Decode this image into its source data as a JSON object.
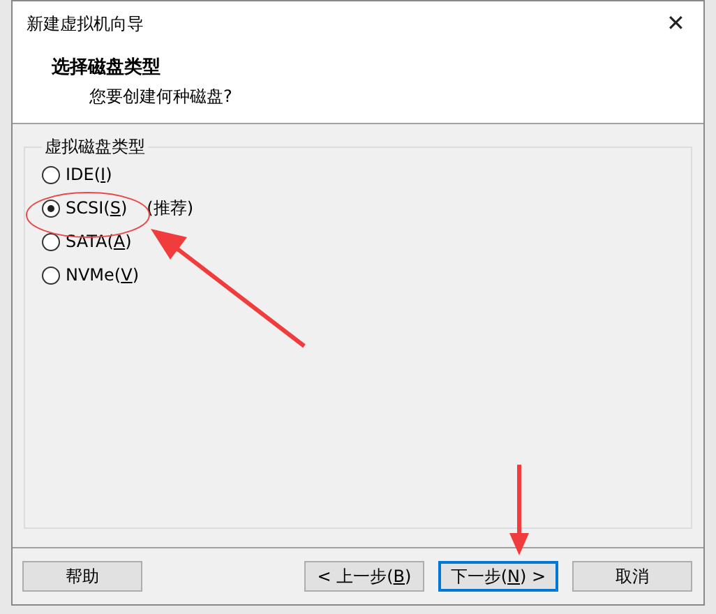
{
  "window": {
    "title": "新建虚拟机向导",
    "close": "✕"
  },
  "header": {
    "title": "选择磁盘类型",
    "subtitle": "您要创建何种磁盘?"
  },
  "group": {
    "title": "虚拟磁盘类型",
    "options": [
      {
        "label": "IDE(I)",
        "selected": false
      },
      {
        "label": "SCSI(S)",
        "selected": true,
        "note": "(推荐)"
      },
      {
        "label": "SATA(A)",
        "selected": false
      },
      {
        "label": "NVMe(V)",
        "selected": false
      }
    ]
  },
  "buttons": [
    {
      "label": "帮助",
      "focused": false
    },
    {
      "label": "< 上一步(B)",
      "focused": false
    },
    {
      "label": "下一步(N) >",
      "focused": true
    },
    {
      "label": "取消",
      "focused": false
    }
  ]
}
